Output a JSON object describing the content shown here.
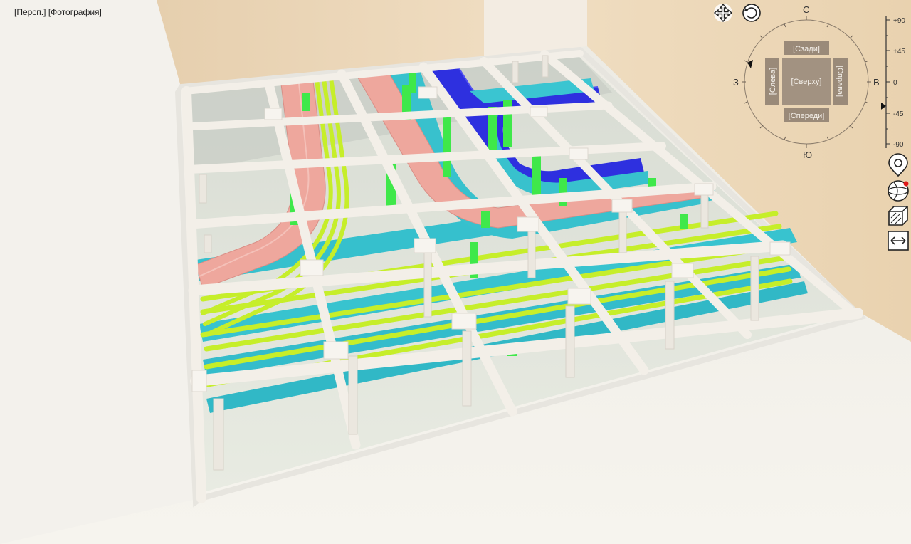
{
  "viewport": {
    "label_view": "[Персп.]",
    "label_style": "[Фотография]"
  },
  "view_cube": {
    "back": "[Сзади]",
    "top": "[Сверху]",
    "left": "[Слева]",
    "right": "[Справа]",
    "front": "[Спереди]"
  },
  "compass": {
    "north": "С",
    "south": "Ю",
    "west": "З",
    "east": "В"
  },
  "tilt_scale": {
    "ticks": [
      "+90",
      "+45",
      "0",
      "-45",
      "-90"
    ],
    "current_angle_deg": -35
  },
  "toolbar_icons": [
    "pan-icon",
    "orbit-icon",
    "location-pin-icon",
    "globe-icon",
    "box-section-icon",
    "extent-icon"
  ],
  "colors": {
    "wall": "#ebd3b0",
    "floor": "#f1eee6",
    "structure": "#f2eee8",
    "tray_cyan": "#33bfcc",
    "tray_blue": "#2f2fe0",
    "cable_salmon": "#eca79e",
    "pipe_lime": "#c6ee2a",
    "support_green": "#3de847"
  }
}
